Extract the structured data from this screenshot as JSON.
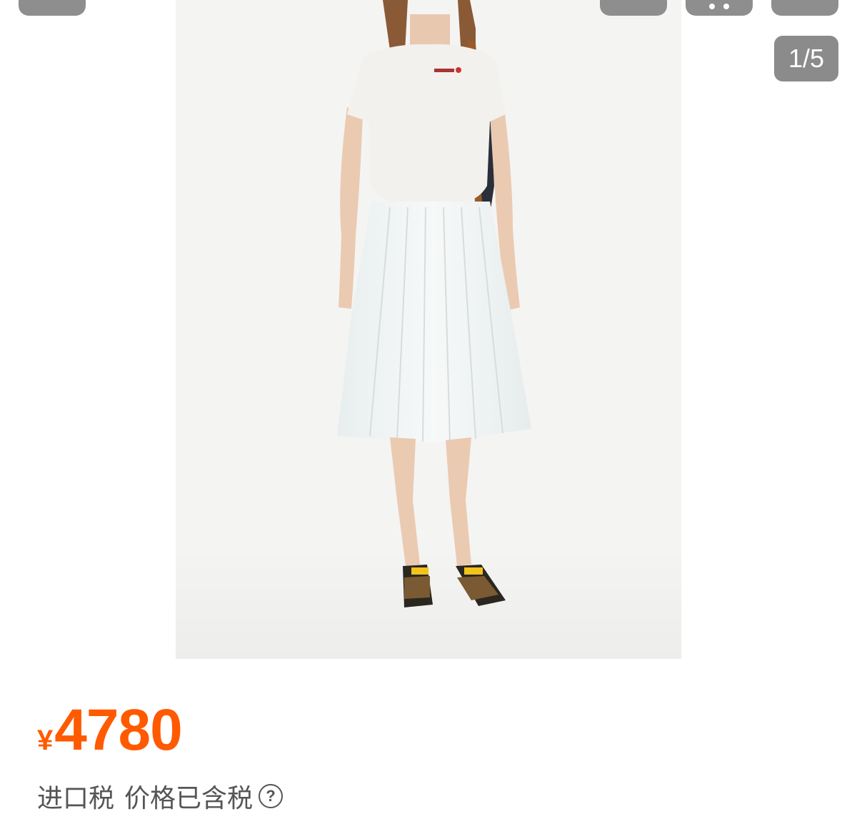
{
  "pager": {
    "current": "1",
    "total": "5",
    "text": "1/5"
  },
  "product": {
    "price_currency": "¥",
    "price_amount": "4780",
    "tax_label": "进口税",
    "tax_note": "价格已含税",
    "help_symbol": "?"
  },
  "icons": {
    "back": "back-icon",
    "share": "share-icon",
    "more": "more-icon",
    "cart": "cart-icon",
    "help": "question-circle-icon"
  },
  "colors": {
    "price": "#ff5a00",
    "overlay_button": "#8e8e8e",
    "tax_text": "#555555"
  }
}
